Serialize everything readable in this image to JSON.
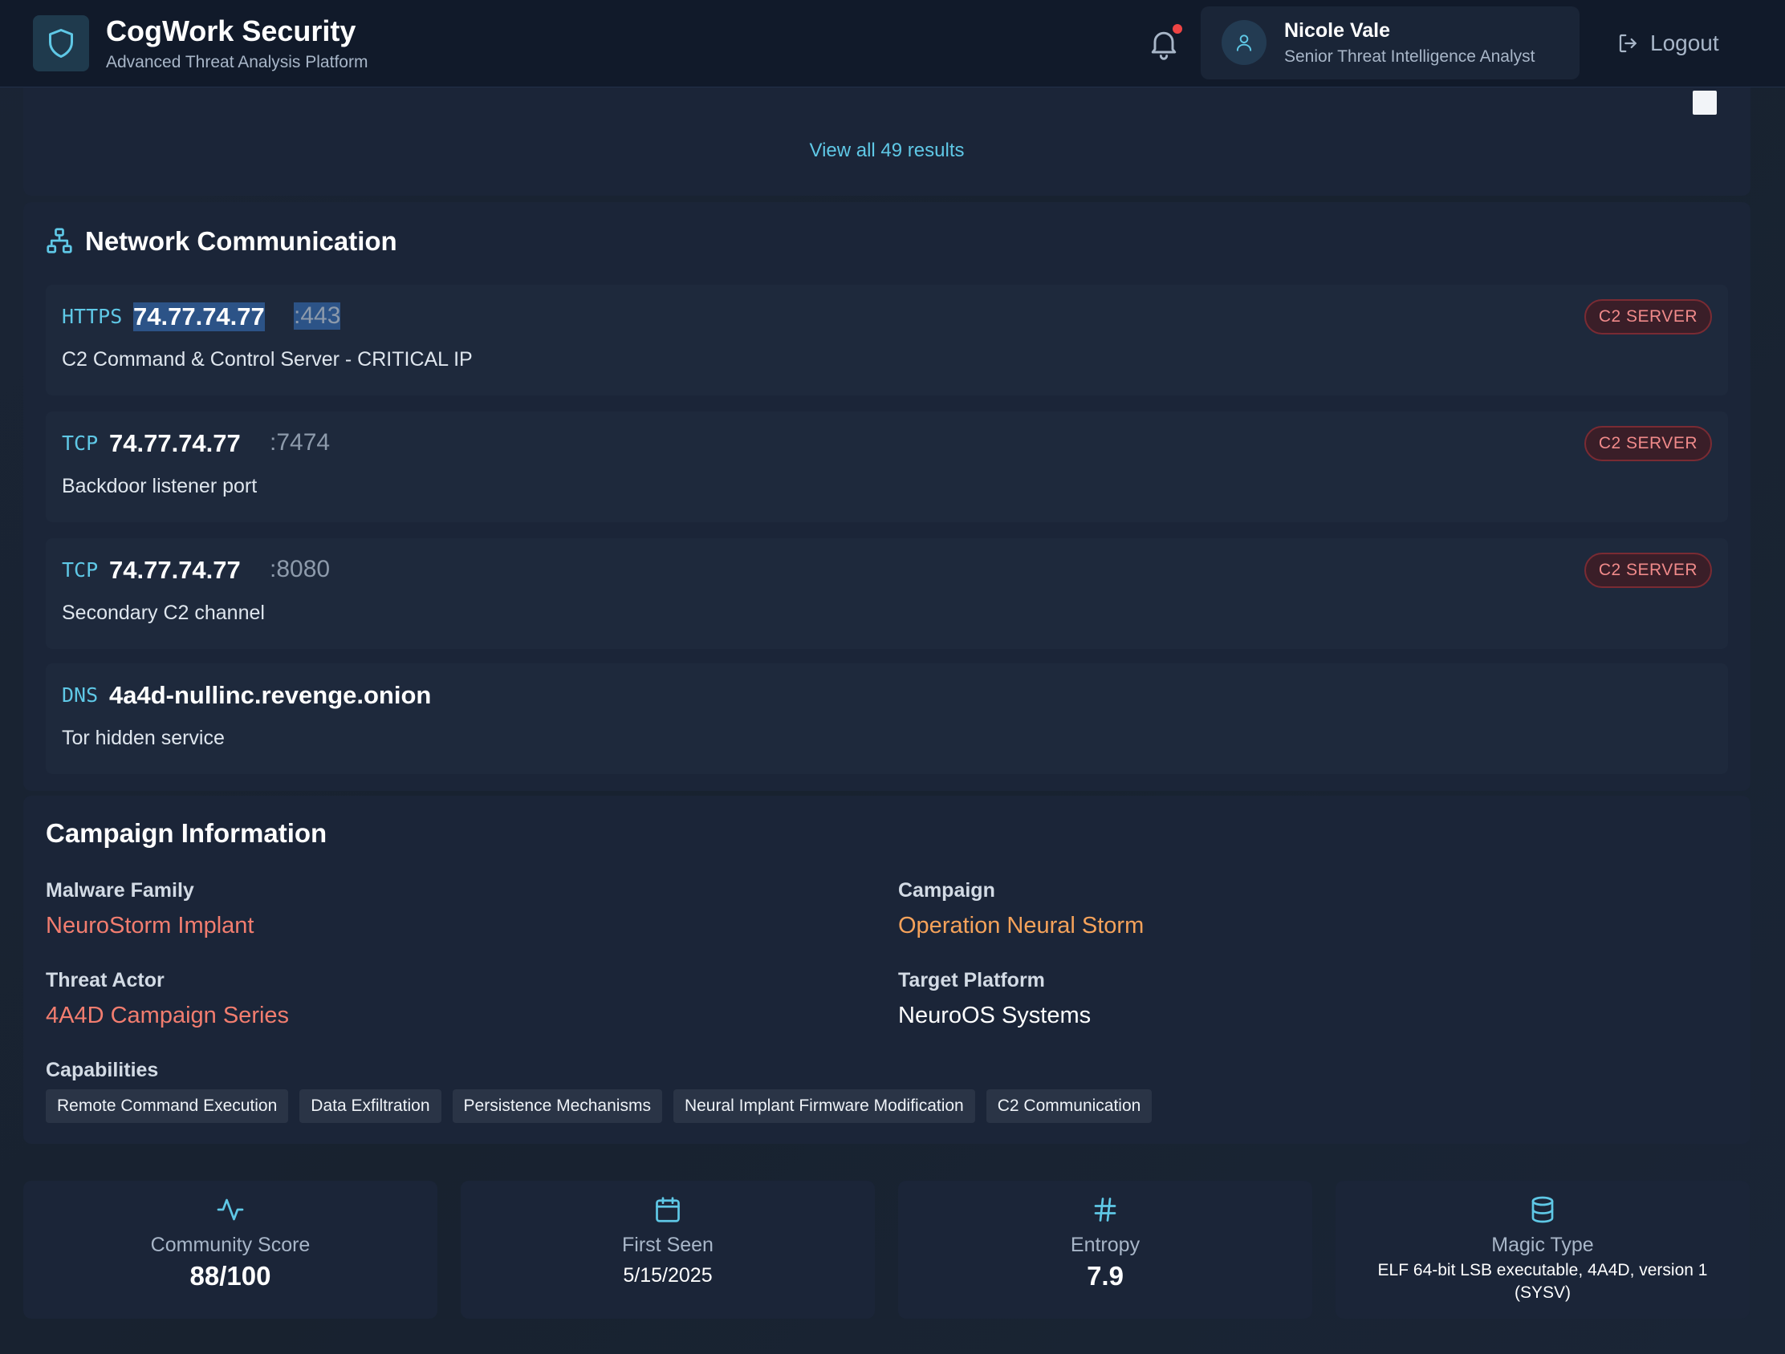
{
  "header": {
    "title": "CogWork Security",
    "subtitle": "Advanced Threat Analysis Platform",
    "user": {
      "name": "Nicole Vale",
      "role": "Senior Threat Intelligence Analyst"
    },
    "logout_label": "Logout"
  },
  "results": {
    "view_all_label": "View all 49 results"
  },
  "network": {
    "title": "Network Communication",
    "connections": [
      {
        "protocol": "HTTPS",
        "host": "74.77.74.77",
        "port": ":443",
        "description": "C2 Command & Control Server - CRITICAL IP",
        "badge": "C2 SERVER"
      },
      {
        "protocol": "TCP",
        "host": "74.77.74.77",
        "port": ":7474",
        "description": "Backdoor listener port",
        "badge": "C2 SERVER"
      },
      {
        "protocol": "TCP",
        "host": "74.77.74.77",
        "port": ":8080",
        "description": "Secondary C2 channel",
        "badge": "C2 SERVER"
      },
      {
        "protocol": "DNS",
        "host": "4a4d-nullinc.revenge.onion",
        "port": "",
        "description": "Tor hidden service",
        "badge": ""
      }
    ]
  },
  "campaign": {
    "title": "Campaign Information",
    "malware_family_label": "Malware Family",
    "malware_family": "NeuroStorm Implant",
    "campaign_label": "Campaign",
    "campaign": "Operation Neural Storm",
    "threat_actor_label": "Threat Actor",
    "threat_actor": "4A4D Campaign Series",
    "target_platform_label": "Target Platform",
    "target_platform": "NeuroOS Systems",
    "capabilities_label": "Capabilities",
    "capabilities": [
      "Remote Command Execution",
      "Data Exfiltration",
      "Persistence Mechanisms",
      "Neural Implant Firmware Modification",
      "C2 Communication"
    ]
  },
  "stats": [
    {
      "icon": "activity-icon",
      "label": "Community Score",
      "value": "88/100"
    },
    {
      "icon": "calendar-icon",
      "label": "First Seen",
      "value": "5/15/2025"
    },
    {
      "icon": "hash-icon",
      "label": "Entropy",
      "value": "7.9"
    },
    {
      "icon": "database-icon",
      "label": "Magic Type",
      "value": "ELF 64-bit LSB executable, 4A4D, version 1 (SYSV)"
    }
  ],
  "colors": {
    "accent": "#5fc8e6",
    "danger": "#f27d6f",
    "warning": "#f5a25a",
    "background": "#182232"
  }
}
